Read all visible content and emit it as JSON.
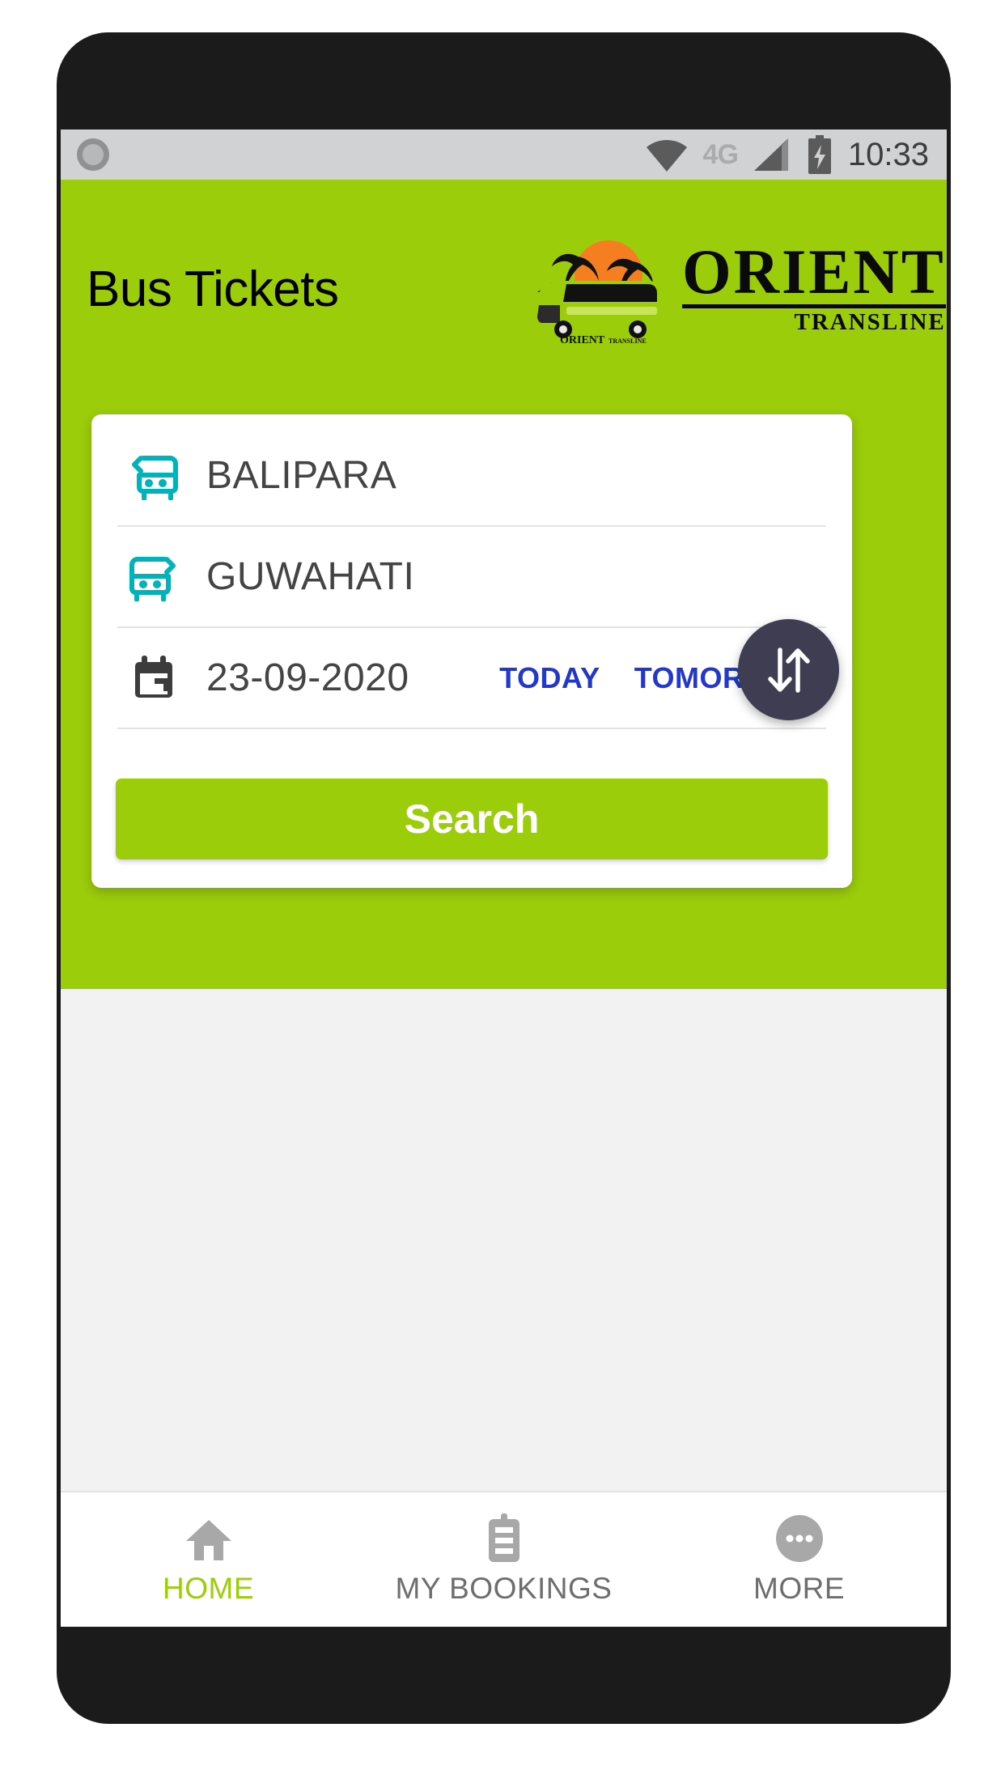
{
  "statusbar": {
    "network_label": "4G",
    "time": "10:33",
    "icons": [
      "camera-dot-icon",
      "wifi-icon",
      "signal-icon",
      "battery-charging-icon"
    ]
  },
  "header": {
    "title": "Bus Tickets",
    "brand_name": "ORIENT",
    "brand_sub": "TRANSLINE",
    "bg_color": "#9ccd0b"
  },
  "search": {
    "from": {
      "label": "BALIPARA",
      "icon": "bus-departure-icon"
    },
    "to": {
      "label": "GUWAHATI",
      "icon": "bus-arrival-icon"
    },
    "date": {
      "value": "23-09-2020",
      "icon": "calendar-icon"
    },
    "today_label": "TODAY",
    "tomorrow_label": "TOMORROW",
    "search_label": "Search",
    "swap_icon": "swap-vertical-icon",
    "link_color": "#2338cb",
    "icon_color": "#00b3ba",
    "fab_color": "#3f3d52"
  },
  "bottom_nav": {
    "items": [
      {
        "label": "HOME",
        "icon": "home-icon",
        "active": true
      },
      {
        "label": "MY BOOKINGS",
        "icon": "clipboard-icon",
        "active": false
      },
      {
        "label": "MORE",
        "icon": "more-dots-icon",
        "active": false
      }
    ],
    "active_color": "#9ccd0b",
    "inactive_color": "#6e6e6e"
  }
}
